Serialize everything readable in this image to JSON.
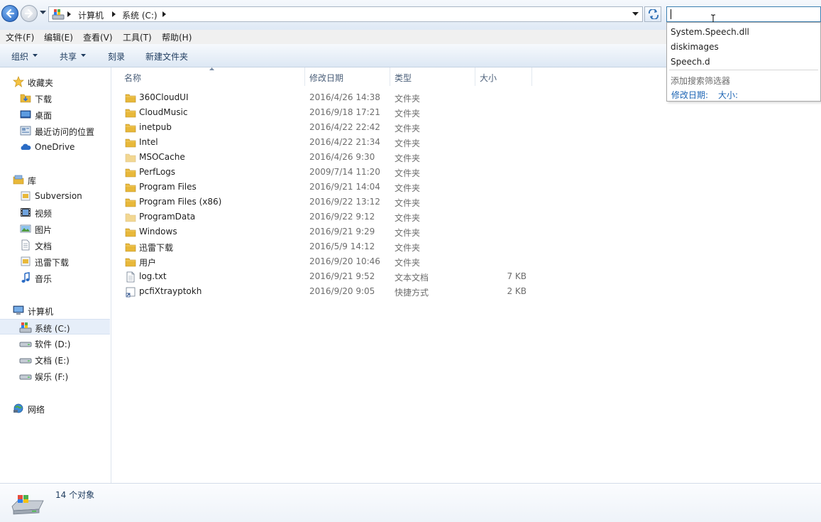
{
  "address": {
    "crumbs": [
      "计算机",
      "系统 (C:)"
    ],
    "search_value": ""
  },
  "menu": [
    "文件(F)",
    "编辑(E)",
    "查看(V)",
    "工具(T)",
    "帮助(H)"
  ],
  "commands": [
    {
      "label": "组织",
      "has_dropdown": true
    },
    {
      "label": "共享",
      "has_dropdown": true
    },
    {
      "label": "刻录",
      "has_dropdown": false
    },
    {
      "label": "新建文件夹",
      "has_dropdown": false
    }
  ],
  "nav": {
    "favorites": {
      "label": "收藏夹",
      "icon": "star-icon"
    },
    "favorites_items": [
      {
        "label": "下载",
        "icon": "download-folder-icon"
      },
      {
        "label": "桌面",
        "icon": "desktop-icon"
      },
      {
        "label": "最近访问的位置",
        "icon": "recent-places-icon"
      },
      {
        "label": "OneDrive",
        "icon": "onedrive-icon"
      }
    ],
    "libraries": {
      "label": "库",
      "icon": "library-icon"
    },
    "library_items": [
      {
        "label": "Subversion",
        "icon": "library-folder-icon"
      },
      {
        "label": "视频",
        "icon": "video-library-icon"
      },
      {
        "label": "图片",
        "icon": "picture-library-icon"
      },
      {
        "label": "文档",
        "icon": "document-library-icon"
      },
      {
        "label": "迅雷下载",
        "icon": "library-folder-icon"
      },
      {
        "label": "音乐",
        "icon": "music-library-icon"
      }
    ],
    "computer": {
      "label": "计算机",
      "icon": "computer-icon"
    },
    "drives": [
      {
        "label": "系统 (C:)",
        "icon": "system-drive-icon",
        "selected": true
      },
      {
        "label": "软件 (D:)",
        "icon": "drive-icon",
        "selected": false
      },
      {
        "label": "文档 (E:)",
        "icon": "drive-icon",
        "selected": false
      },
      {
        "label": "娱乐 (F:)",
        "icon": "drive-icon",
        "selected": false
      }
    ],
    "network": {
      "label": "网络",
      "icon": "network-icon"
    }
  },
  "columns": {
    "name": "名称",
    "date": "修改日期",
    "type": "类型",
    "size": "大小"
  },
  "files": [
    {
      "name": "360CloudUI",
      "date": "2016/4/26 14:38",
      "type": "文件夹",
      "size": "",
      "icon": "folder-icon"
    },
    {
      "name": "CloudMusic",
      "date": "2016/9/18 17:21",
      "type": "文件夹",
      "size": "",
      "icon": "folder-icon"
    },
    {
      "name": "inetpub",
      "date": "2016/4/22 22:42",
      "type": "文件夹",
      "size": "",
      "icon": "folder-icon"
    },
    {
      "name": "Intel",
      "date": "2016/4/22 21:34",
      "type": "文件夹",
      "size": "",
      "icon": "folder-icon"
    },
    {
      "name": "MSOCache",
      "date": "2016/4/26 9:30",
      "type": "文件夹",
      "size": "",
      "icon": "hidden-folder-icon"
    },
    {
      "name": "PerfLogs",
      "date": "2009/7/14 11:20",
      "type": "文件夹",
      "size": "",
      "icon": "folder-icon"
    },
    {
      "name": "Program Files",
      "date": "2016/9/21 14:04",
      "type": "文件夹",
      "size": "",
      "icon": "folder-icon"
    },
    {
      "name": "Program Files (x86)",
      "date": "2016/9/22 13:12",
      "type": "文件夹",
      "size": "",
      "icon": "folder-icon"
    },
    {
      "name": "ProgramData",
      "date": "2016/9/22 9:12",
      "type": "文件夹",
      "size": "",
      "icon": "hidden-folder-icon"
    },
    {
      "name": "Windows",
      "date": "2016/9/21 9:29",
      "type": "文件夹",
      "size": "",
      "icon": "folder-icon"
    },
    {
      "name": "迅雷下载",
      "date": "2016/5/9 14:12",
      "type": "文件夹",
      "size": "",
      "icon": "folder-icon"
    },
    {
      "name": "用户",
      "date": "2016/9/20 10:46",
      "type": "文件夹",
      "size": "",
      "icon": "folder-icon"
    },
    {
      "name": "log.txt",
      "date": "2016/9/21 9:52",
      "type": "文本文档",
      "size": "7 KB",
      "icon": "text-file-icon"
    },
    {
      "name": "pcfiXtrayptokh",
      "date": "2016/9/20 9:05",
      "type": "快捷方式",
      "size": "2 KB",
      "icon": "shortcut-icon"
    }
  ],
  "search_dropdown": {
    "suggestions": [
      "System.Speech.dll",
      "diskimages",
      "Speech.d"
    ],
    "filter_title": "添加搜索筛选器",
    "filters": [
      "修改日期:",
      "大小:"
    ]
  },
  "status": {
    "count": "14 个对象"
  },
  "colors": {
    "accent": "#1c64b4",
    "folder": "#e8b83a",
    "selection": "#e6eef9"
  }
}
